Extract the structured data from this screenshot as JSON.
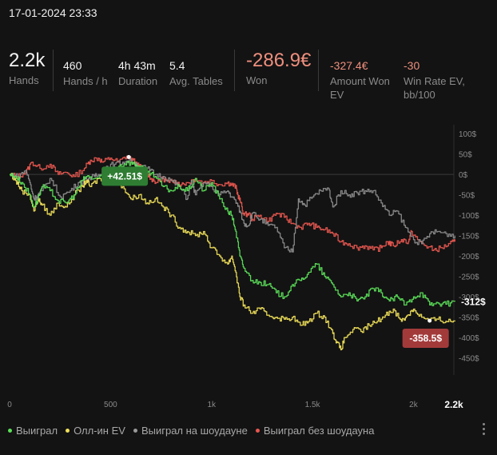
{
  "header": {
    "datetime": "17-01-2024 23:33"
  },
  "stats": {
    "hands": {
      "value": "2.2k",
      "label": "Hands"
    },
    "hands_per_hour": {
      "value": "460",
      "label": "Hands / h"
    },
    "duration": {
      "value": "4h 43m",
      "label": "Duration"
    },
    "avg_tables": {
      "value": "5.4",
      "label": "Avg. Tables"
    },
    "won": {
      "value": "-286.9€",
      "label": "Won"
    },
    "amount_won_ev": {
      "value": "-327.4€",
      "label_line1": "Amount Won",
      "label_line2": "EV"
    },
    "win_rate_ev": {
      "value": "-30",
      "label_line1": "Win Rate EV,",
      "label_line2": "bb/100"
    }
  },
  "chart_data": {
    "type": "line",
    "xlim": [
      0,
      2200
    ],
    "ylim": [
      -480,
      110
    ],
    "x_ticks": [
      {
        "value": 0,
        "label": "0"
      },
      {
        "value": 500,
        "label": "500"
      },
      {
        "value": 1000,
        "label": "1k"
      },
      {
        "value": 1500,
        "label": "1.5k"
      },
      {
        "value": 2000,
        "label": "2k"
      }
    ],
    "x_end_label": "2.2k",
    "y_ticks": [
      {
        "value": 100,
        "label": "100$"
      },
      {
        "value": 50,
        "label": "50$"
      },
      {
        "value": 0,
        "label": "0$"
      },
      {
        "value": -50,
        "label": "-50$"
      },
      {
        "value": -100,
        "label": "-100$"
      },
      {
        "value": -150,
        "label": "-150$"
      },
      {
        "value": -200,
        "label": "-200$"
      },
      {
        "value": -250,
        "label": "-250$"
      },
      {
        "value": -300,
        "label": "-300$"
      },
      {
        "value": -350,
        "label": "-350$"
      },
      {
        "value": -400,
        "label": "-400$"
      },
      {
        "value": -450,
        "label": "-450$"
      }
    ],
    "series": [
      {
        "name": "Выиграл без шоудауна",
        "color": "#e8564f",
        "points": [
          [
            0,
            0
          ],
          [
            40,
            -5
          ],
          [
            80,
            5
          ],
          [
            110,
            30
          ],
          [
            150,
            15
          ],
          [
            200,
            25
          ],
          [
            240,
            0
          ],
          [
            280,
            5
          ],
          [
            320,
            -5
          ],
          [
            370,
            15
          ],
          [
            400,
            35
          ],
          [
            440,
            40
          ],
          [
            460,
            30
          ],
          [
            500,
            40
          ],
          [
            540,
            30
          ],
          [
            580,
            45
          ],
          [
            610,
            35
          ],
          [
            640,
            20
          ],
          [
            670,
            10
          ],
          [
            700,
            -10
          ],
          [
            730,
            -20
          ],
          [
            760,
            -10
          ],
          [
            790,
            -20
          ],
          [
            820,
            -15
          ],
          [
            850,
            -25
          ],
          [
            880,
            -20
          ],
          [
            920,
            -10
          ],
          [
            960,
            -20
          ],
          [
            1000,
            -15
          ],
          [
            1040,
            -25
          ],
          [
            1080,
            -20
          ],
          [
            1100,
            -25
          ],
          [
            1120,
            -30
          ],
          [
            1130,
            -50
          ],
          [
            1145,
            -70
          ],
          [
            1160,
            -100
          ],
          [
            1185,
            -95
          ],
          [
            1200,
            -110
          ],
          [
            1240,
            -100
          ],
          [
            1280,
            -115
          ],
          [
            1320,
            -95
          ],
          [
            1360,
            -105
          ],
          [
            1400,
            -120
          ],
          [
            1440,
            -130
          ],
          [
            1480,
            -120
          ],
          [
            1520,
            -130
          ],
          [
            1560,
            -135
          ],
          [
            1600,
            -145
          ],
          [
            1640,
            -165
          ],
          [
            1680,
            -170
          ],
          [
            1720,
            -180
          ],
          [
            1760,
            -175
          ],
          [
            1800,
            -185
          ],
          [
            1840,
            -180
          ],
          [
            1870,
            -165
          ],
          [
            1900,
            -175
          ],
          [
            1940,
            -160
          ],
          [
            1975,
            -165
          ],
          [
            1990,
            -140
          ],
          [
            2020,
            -160
          ],
          [
            2060,
            -175
          ],
          [
            2100,
            -185
          ],
          [
            2140,
            -180
          ],
          [
            2180,
            -170
          ],
          [
            2205,
            -165
          ]
        ]
      },
      {
        "name": "Выиграл на шоудауне",
        "color": "#8c8c8c",
        "points": [
          [
            0,
            0
          ],
          [
            40,
            -5
          ],
          [
            80,
            10
          ],
          [
            100,
            -20
          ],
          [
            120,
            -60
          ],
          [
            140,
            -50
          ],
          [
            160,
            -40
          ],
          [
            200,
            -10
          ],
          [
            250,
            -55
          ],
          [
            300,
            -40
          ],
          [
            340,
            -20
          ],
          [
            390,
            -10
          ],
          [
            420,
            -5
          ],
          [
            450,
            0
          ],
          [
            480,
            20
          ],
          [
            520,
            25
          ],
          [
            560,
            30
          ],
          [
            600,
            35
          ],
          [
            640,
            20
          ],
          [
            680,
            15
          ],
          [
            720,
            0
          ],
          [
            760,
            -5
          ],
          [
            800,
            -15
          ],
          [
            840,
            -30
          ],
          [
            880,
            -60
          ],
          [
            900,
            -15
          ],
          [
            920,
            -50
          ],
          [
            960,
            -20
          ],
          [
            1000,
            -30
          ],
          [
            1040,
            -50
          ],
          [
            1080,
            -40
          ],
          [
            1100,
            -55
          ],
          [
            1125,
            -70
          ],
          [
            1140,
            -90
          ],
          [
            1160,
            -120
          ],
          [
            1185,
            -125
          ],
          [
            1200,
            -95
          ],
          [
            1240,
            -110
          ],
          [
            1280,
            -125
          ],
          [
            1320,
            -130
          ],
          [
            1360,
            -180
          ],
          [
            1400,
            -190
          ],
          [
            1430,
            -60
          ],
          [
            1460,
            -75
          ],
          [
            1500,
            -55
          ],
          [
            1540,
            -40
          ],
          [
            1580,
            -35
          ],
          [
            1600,
            -80
          ],
          [
            1640,
            -40
          ],
          [
            1680,
            -50
          ],
          [
            1720,
            -45
          ],
          [
            1760,
            -40
          ],
          [
            1800,
            -40
          ],
          [
            1840,
            -70
          ],
          [
            1880,
            -100
          ],
          [
            1920,
            -90
          ],
          [
            1960,
            -130
          ],
          [
            2000,
            -160
          ],
          [
            2040,
            -170
          ],
          [
            2080,
            -145
          ],
          [
            2120,
            -140
          ],
          [
            2160,
            -145
          ],
          [
            2205,
            -150
          ]
        ]
      },
      {
        "name": "Олл-ин EV",
        "color": "#f0e05a",
        "points": [
          [
            0,
            0
          ],
          [
            30,
            -15
          ],
          [
            60,
            -40
          ],
          [
            100,
            -50
          ],
          [
            120,
            -90
          ],
          [
            140,
            -60
          ],
          [
            160,
            -75
          ],
          [
            200,
            -100
          ],
          [
            240,
            -70
          ],
          [
            280,
            -80
          ],
          [
            320,
            -50
          ],
          [
            360,
            -30
          ],
          [
            380,
            -15
          ],
          [
            400,
            -30
          ],
          [
            440,
            -10
          ],
          [
            480,
            -20
          ],
          [
            520,
            -10
          ],
          [
            560,
            -30
          ],
          [
            600,
            -60
          ],
          [
            640,
            -50
          ],
          [
            680,
            -70
          ],
          [
            720,
            -60
          ],
          [
            760,
            -80
          ],
          [
            800,
            -100
          ],
          [
            840,
            -130
          ],
          [
            880,
            -140
          ],
          [
            920,
            -150
          ],
          [
            960,
            -140
          ],
          [
            1000,
            -180
          ],
          [
            1040,
            -200
          ],
          [
            1080,
            -220
          ],
          [
            1100,
            -200
          ],
          [
            1120,
            -240
          ],
          [
            1140,
            -300
          ],
          [
            1160,
            -320
          ],
          [
            1200,
            -340
          ],
          [
            1240,
            -330
          ],
          [
            1280,
            -345
          ],
          [
            1320,
            -350
          ],
          [
            1360,
            -355
          ],
          [
            1400,
            -350
          ],
          [
            1440,
            -370
          ],
          [
            1480,
            -360
          ],
          [
            1520,
            -340
          ],
          [
            1560,
            -350
          ],
          [
            1600,
            -390
          ],
          [
            1620,
            -410
          ],
          [
            1640,
            -430
          ],
          [
            1660,
            -400
          ],
          [
            1700,
            -380
          ],
          [
            1740,
            -385
          ],
          [
            1780,
            -370
          ],
          [
            1820,
            -360
          ],
          [
            1860,
            -345
          ],
          [
            1900,
            -330
          ],
          [
            1940,
            -360
          ],
          [
            1970,
            -345
          ],
          [
            2000,
            -330
          ],
          [
            2040,
            -350
          ],
          [
            2080,
            -358
          ],
          [
            2120,
            -355
          ],
          [
            2160,
            -360
          ],
          [
            2205,
            -358
          ]
        ]
      },
      {
        "name": "Выиграл",
        "color": "#5ce05a",
        "points": [
          [
            0,
            0
          ],
          [
            30,
            -5
          ],
          [
            60,
            -20
          ],
          [
            100,
            -50
          ],
          [
            120,
            -80
          ],
          [
            140,
            -60
          ],
          [
            160,
            -30
          ],
          [
            200,
            -40
          ],
          [
            240,
            -65
          ],
          [
            280,
            -70
          ],
          [
            320,
            -50
          ],
          [
            360,
            -15
          ],
          [
            380,
            -5
          ],
          [
            420,
            -10
          ],
          [
            460,
            -5
          ],
          [
            500,
            10
          ],
          [
            540,
            20
          ],
          [
            580,
            30
          ],
          [
            620,
            25
          ],
          [
            640,
            20
          ],
          [
            680,
            5
          ],
          [
            720,
            -5
          ],
          [
            760,
            -30
          ],
          [
            800,
            -40
          ],
          [
            840,
            -30
          ],
          [
            880,
            -40
          ],
          [
            920,
            -10
          ],
          [
            960,
            -40
          ],
          [
            1000,
            -20
          ],
          [
            1040,
            -60
          ],
          [
            1080,
            -90
          ],
          [
            1100,
            -100
          ],
          [
            1120,
            -140
          ],
          [
            1140,
            -200
          ],
          [
            1160,
            -230
          ],
          [
            1200,
            -260
          ],
          [
            1240,
            -265
          ],
          [
            1280,
            -270
          ],
          [
            1320,
            -290
          ],
          [
            1360,
            -300
          ],
          [
            1400,
            -270
          ],
          [
            1440,
            -260
          ],
          [
            1480,
            -240
          ],
          [
            1520,
            -220
          ],
          [
            1560,
            -250
          ],
          [
            1600,
            -270
          ],
          [
            1640,
            -300
          ],
          [
            1680,
            -290
          ],
          [
            1720,
            -310
          ],
          [
            1760,
            -300
          ],
          [
            1800,
            -280
          ],
          [
            1840,
            -290
          ],
          [
            1880,
            -310
          ],
          [
            1920,
            -300
          ],
          [
            1960,
            -320
          ],
          [
            2000,
            -300
          ],
          [
            2040,
            -290
          ],
          [
            2080,
            -320
          ],
          [
            2120,
            -315
          ],
          [
            2160,
            -318
          ],
          [
            2205,
            -312
          ]
        ]
      }
    ],
    "annotations": [
      {
        "label": "+42.51$",
        "x": 590,
        "y": 42.51,
        "color": "#2e7d32"
      },
      {
        "label": "-358.5$",
        "x": 2080,
        "y": -358.5,
        "color": "#a33a3a"
      }
    ],
    "end_labels": [
      {
        "label": "-312$",
        "y": -312
      }
    ]
  },
  "legend": {
    "items": [
      {
        "label": "Выиграл",
        "color": "#5ce05a"
      },
      {
        "label": "Олл-ин EV",
        "color": "#f0e05a"
      },
      {
        "label": "Выиграл на шоудауне",
        "color": "#9a9a9a"
      },
      {
        "label": "Выиграл без шоудауна",
        "color": "#e8564f"
      }
    ]
  }
}
